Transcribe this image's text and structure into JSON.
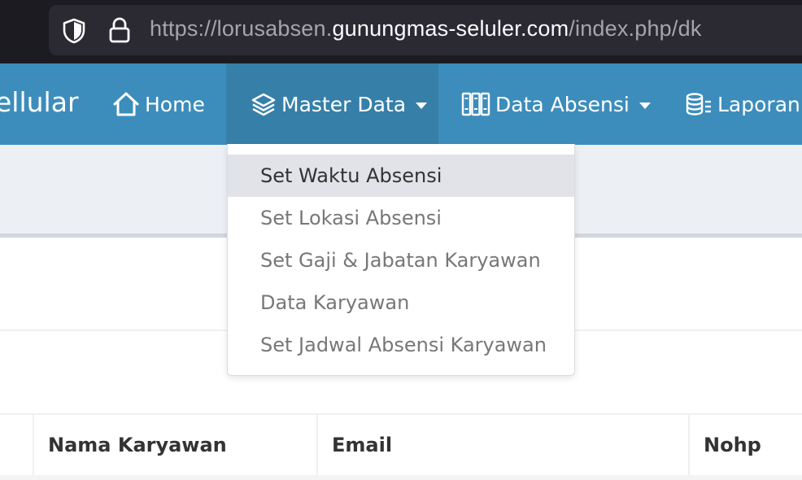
{
  "browser": {
    "url_prefix": "https://lorusabsen.",
    "url_host": "gunungmas-seluler.com",
    "url_path": "/index.php/dk"
  },
  "navbar": {
    "brand": "ellular",
    "home_label": "Home",
    "master_label": "Master Data",
    "absensi_label": "Data Absensi",
    "laporan_label": "Laporan"
  },
  "dropdown": {
    "items": [
      {
        "label": "Set Waktu Absensi"
      },
      {
        "label": "Set Lokasi Absensi"
      },
      {
        "label": "Set Gaji & Jabatan Karyawan"
      },
      {
        "label": "Data Karyawan"
      },
      {
        "label": "Set Jadwal Absensi Karyawan"
      }
    ]
  },
  "table": {
    "headers": [
      "Nama Karyawan",
      "Email",
      "Nohp"
    ]
  },
  "colors": {
    "navbar": "#3c8dbc",
    "navbar_active": "#367fa9",
    "content_bg": "#ecf0f5"
  }
}
